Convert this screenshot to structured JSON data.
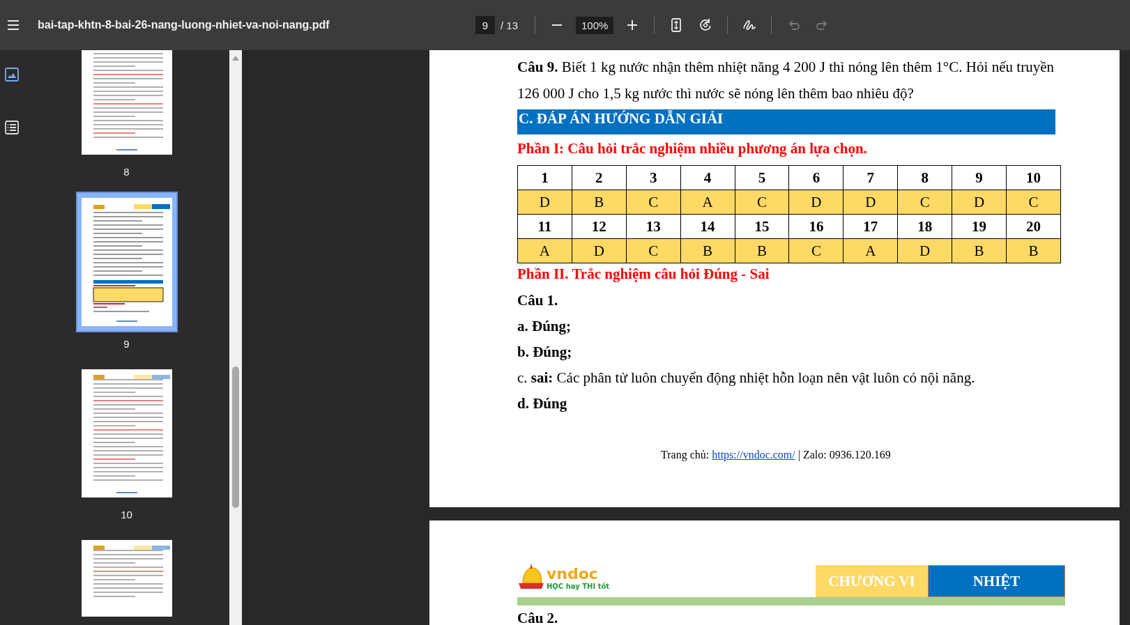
{
  "toolbar": {
    "title": "bai-tap-khtn-8-bai-26-nang-luong-nhiet-va-noi-nang.pdf",
    "page_input": "9",
    "page_total": "/ 13",
    "zoom": "100%",
    "buttons": [
      {
        "kind": "menu",
        "disabled": false
      },
      {
        "kind": "zoom-out",
        "disabled": false
      },
      {
        "kind": "zoom-in",
        "disabled": false
      },
      {
        "kind": "fit",
        "disabled": false
      },
      {
        "kind": "rotate",
        "disabled": false
      },
      {
        "kind": "draw",
        "disabled": false
      },
      {
        "kind": "undo",
        "disabled": true
      },
      {
        "kind": "redo",
        "disabled": true
      }
    ]
  },
  "sidebar": {
    "tabs": [
      {
        "kind": "thumbnails",
        "selected": true
      },
      {
        "kind": "outline",
        "selected": false
      }
    ],
    "thumbnails": [
      {
        "label": "8",
        "selected": false,
        "kind": "cut-top"
      },
      {
        "label": "9",
        "selected": true,
        "kind": "full"
      },
      {
        "label": "10",
        "selected": false,
        "kind": "full"
      },
      {
        "kind": "cut-bottom",
        "selected": false
      }
    ]
  },
  "page_1": {
    "question": "**Câu 9.** Biết 1 kg nước nhận thêm nhiệt năng 4 200 J thì nóng lên thêm 1°C. Hỏi nếu truyền 126 000 J cho 1,5 kg nước thì nước sẽ nóng lên thêm bao nhiêu độ?",
    "section_heading": "C. ĐÁP ÁN HƯỚNG DẪN GIẢI",
    "part_1_heading": "Phần I: Câu hỏi trắc nghiệm nhiều phương án lựa chọn.",
    "answer_table": {
      "rows": [
        {
          "kind": "number",
          "cells": [
            "1",
            "2",
            "3",
            "4",
            "5",
            "6",
            "7",
            "8",
            "9",
            "10"
          ]
        },
        {
          "kind": "answer",
          "cells": [
            "D",
            "B",
            "C",
            "A",
            "C",
            "D",
            "D",
            "C",
            "D",
            "C"
          ]
        },
        {
          "kind": "number",
          "cells": [
            "11",
            "12",
            "13",
            "14",
            "15",
            "16",
            "17",
            "18",
            "19",
            "20"
          ]
        },
        {
          "kind": "answer",
          "cells": [
            "A",
            "D",
            "C",
            "B",
            "B",
            "C",
            "A",
            "D",
            "B",
            "B"
          ]
        }
      ]
    },
    "part_2_heading": "Phần II. Trắc nghiệm câu hỏi Đúng - Sai",
    "lines": [
      {
        "kind": "bold",
        "text": "Câu 1."
      },
      {
        "kind": "bold",
        "text": "a. Đúng;"
      },
      {
        "kind": "bold",
        "text": "b. Đúng;"
      },
      {
        "kind": "plain",
        "text": "c. **sai:** Các phân tử luôn chuyển động nhiệt hỗn loạn nên vật luôn có nội năng."
      },
      {
        "kind": "bold",
        "text": "d. Đúng"
      }
    ],
    "footer": {
      "prefix": "Trang chủ: ",
      "link": "https://vndoc.com/",
      "suffix": " | Zalo: 0936.120.169"
    }
  },
  "page_2": {
    "logo": {
      "name": "vndoc",
      "slogan": "HỌC hay THI tốt"
    },
    "chapter": "CHƯƠNG VI",
    "topic": "NHIỆT",
    "first_line": "Câu 2."
  }
}
